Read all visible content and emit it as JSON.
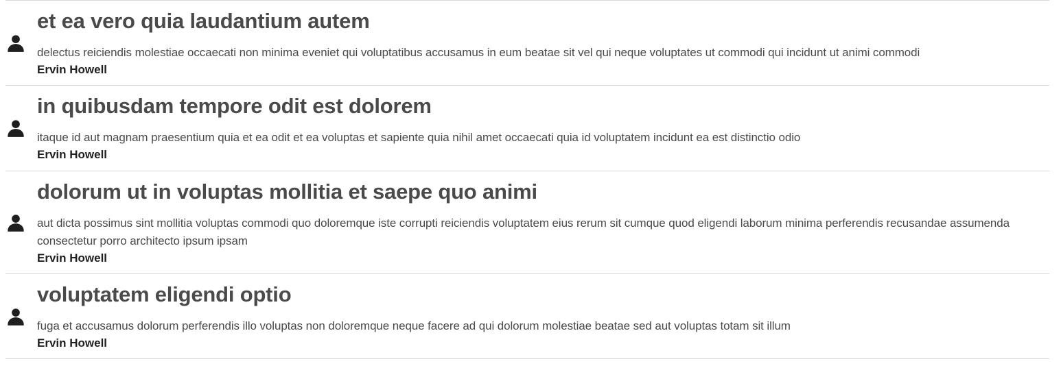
{
  "colors": {
    "title": "#4a4a4a",
    "body": "#4a4a4a",
    "author": "#1f1f1f",
    "divider": "#d8d8d8",
    "icon": "#1f1f1f"
  },
  "posts": [
    {
      "icon": "user-icon",
      "title": "et ea vero quia laudantium autem",
      "body": "delectus reiciendis molestiae occaecati non minima eveniet qui voluptatibus accusamus in eum beatae sit vel qui neque voluptates ut commodi qui incidunt ut animi commodi",
      "author": "Ervin Howell"
    },
    {
      "icon": "user-icon",
      "title": "in quibusdam tempore odit est dolorem",
      "body": "itaque id aut magnam praesentium quia et ea odit et ea voluptas et sapiente quia nihil amet occaecati quia id voluptatem incidunt ea est distinctio odio",
      "author": "Ervin Howell"
    },
    {
      "icon": "user-icon",
      "title": "dolorum ut in voluptas mollitia et saepe quo animi",
      "body": "aut dicta possimus sint mollitia voluptas commodi quo doloremque iste corrupti reiciendis voluptatem eius rerum sit cumque quod eligendi laborum minima perferendis recusandae assumenda consectetur porro architecto ipsum ipsam",
      "author": "Ervin Howell"
    },
    {
      "icon": "user-icon",
      "title": "voluptatem eligendi optio",
      "body": "fuga et accusamus dolorum perferendis illo voluptas non doloremque neque facere ad qui dolorum molestiae beatae sed aut voluptas totam sit illum",
      "author": "Ervin Howell"
    }
  ]
}
